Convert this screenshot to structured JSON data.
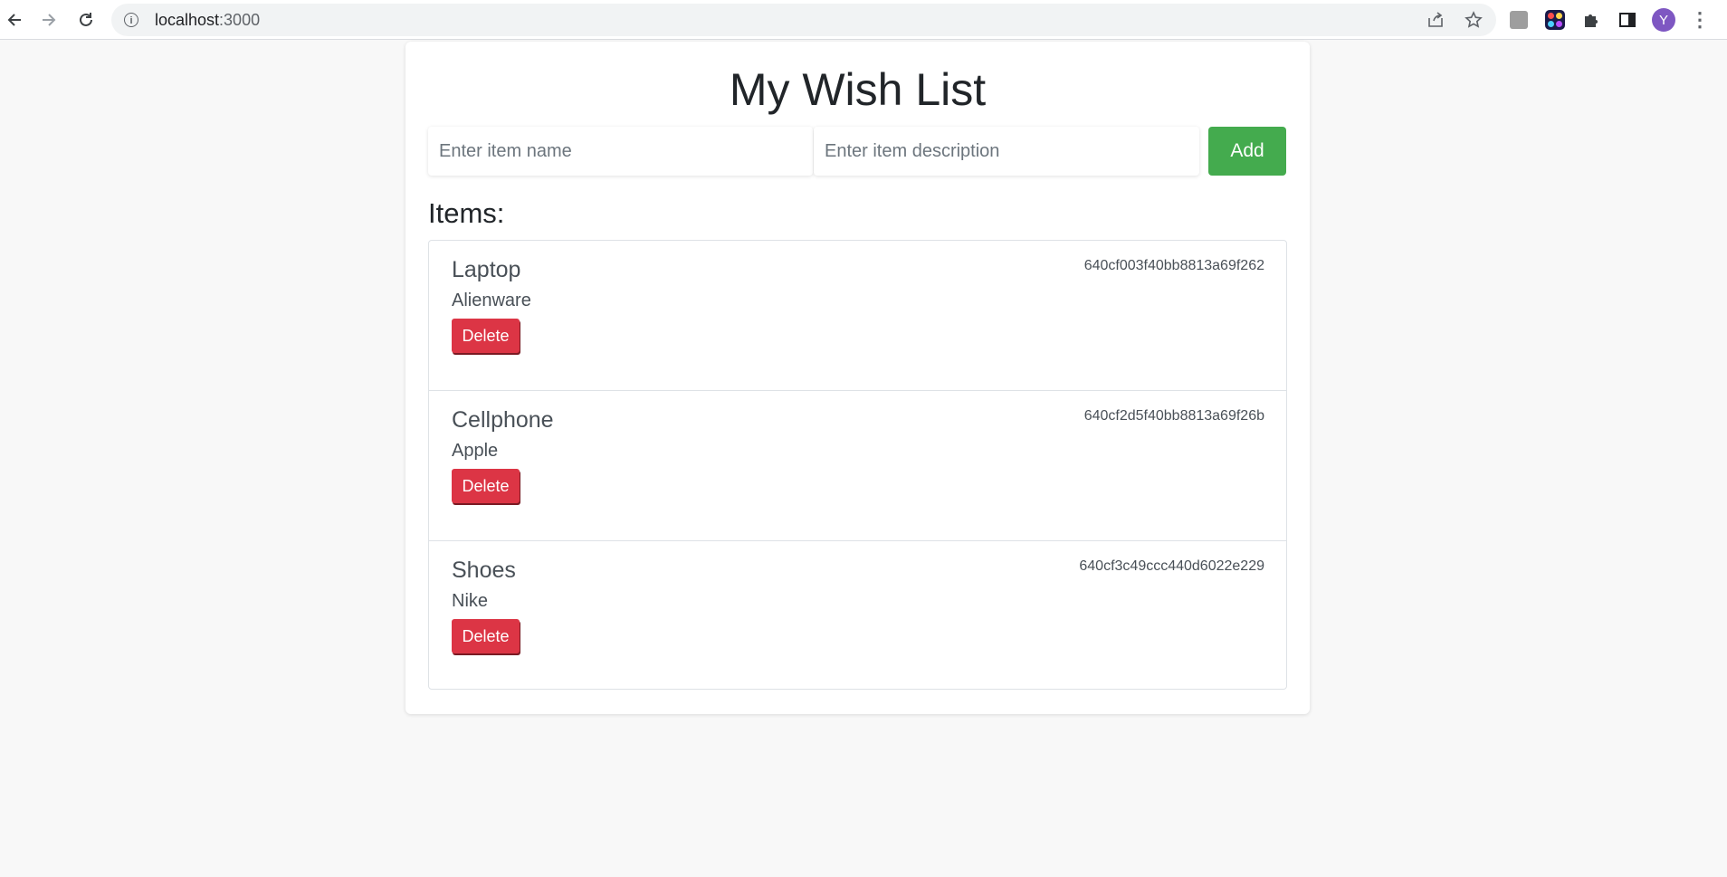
{
  "browser": {
    "url_host": "localhost",
    "url_port": ":3000",
    "avatar_letter": "Y"
  },
  "page": {
    "title": "My Wish List",
    "name_placeholder": "Enter item name",
    "description_placeholder": "Enter item description",
    "add_label": "Add",
    "items_heading": "Items:",
    "delete_label": "Delete",
    "items": [
      {
        "name": "Laptop",
        "description": "Alienware",
        "id": "640cf003f40bb8813a69f262"
      },
      {
        "name": "Cellphone",
        "description": "Apple",
        "id": "640cf2d5f40bb8813a69f26b"
      },
      {
        "name": "Shoes",
        "description": "Nike",
        "id": "640cf3c49ccc440d6022e229"
      }
    ]
  },
  "colors": {
    "add_button": "#44ab4e",
    "delete_button": "#dc3545",
    "background": "#f8f8f8"
  },
  "icons": [
    "back-arrow-icon",
    "forward-arrow-icon",
    "reload-icon",
    "site-info-icon",
    "share-icon",
    "bookmark-star-icon",
    "extension-icon",
    "puzzle-icon",
    "side-panel-icon",
    "menu-kebab-icon"
  ]
}
